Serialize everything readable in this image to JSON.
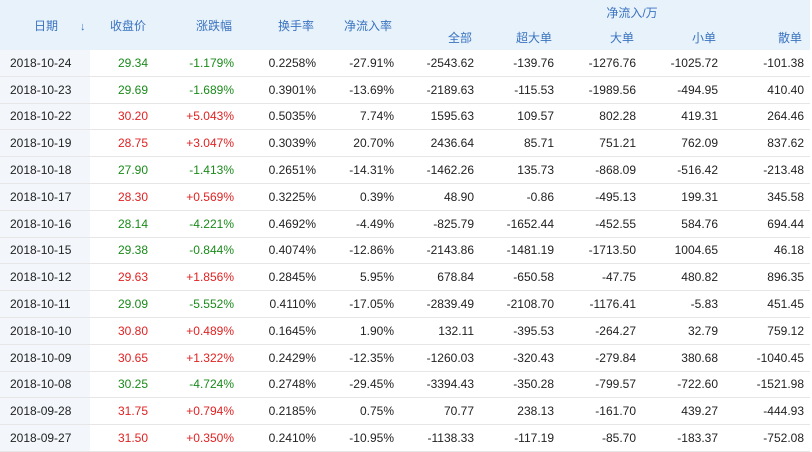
{
  "header": {
    "date": "日期",
    "close": "收盘价",
    "change": "涨跌幅",
    "turnover": "换手率",
    "net_inflow_rate": "净流入率",
    "net_inflow_group": "净流入/万",
    "all": "全部",
    "super_large": "超大单",
    "large": "大单",
    "small": "小单",
    "retail": "散单",
    "sort_icon": "↓"
  },
  "colors": {
    "up": "#e02222",
    "down": "#1a8a1a",
    "header_text": "#3a73c0",
    "header_bg": "#e8f2fb"
  },
  "rows": [
    {
      "date": "2018-10-24",
      "close": "29.34",
      "change": "-1.179%",
      "turnover": "0.2258%",
      "rate": "-27.91%",
      "all": "-2543.62",
      "super": "-139.76",
      "large": "-1276.76",
      "small": "-1025.72",
      "retail": "-101.38",
      "dir": "down"
    },
    {
      "date": "2018-10-23",
      "close": "29.69",
      "change": "-1.689%",
      "turnover": "0.3901%",
      "rate": "-13.69%",
      "all": "-2189.63",
      "super": "-115.53",
      "large": "-1989.56",
      "small": "-494.95",
      "retail": "410.40",
      "dir": "down"
    },
    {
      "date": "2018-10-22",
      "close": "30.20",
      "change": "+5.043%",
      "turnover": "0.5035%",
      "rate": "7.74%",
      "all": "1595.63",
      "super": "109.57",
      "large": "802.28",
      "small": "419.31",
      "retail": "264.46",
      "dir": "up"
    },
    {
      "date": "2018-10-19",
      "close": "28.75",
      "change": "+3.047%",
      "turnover": "0.3039%",
      "rate": "20.70%",
      "all": "2436.64",
      "super": "85.71",
      "large": "751.21",
      "small": "762.09",
      "retail": "837.62",
      "dir": "up"
    },
    {
      "date": "2018-10-18",
      "close": "27.90",
      "change": "-1.413%",
      "turnover": "0.2651%",
      "rate": "-14.31%",
      "all": "-1462.26",
      "super": "135.73",
      "large": "-868.09",
      "small": "-516.42",
      "retail": "-213.48",
      "dir": "down"
    },
    {
      "date": "2018-10-17",
      "close": "28.30",
      "change": "+0.569%",
      "turnover": "0.3225%",
      "rate": "0.39%",
      "all": "48.90",
      "super": "-0.86",
      "large": "-495.13",
      "small": "199.31",
      "retail": "345.58",
      "dir": "up"
    },
    {
      "date": "2018-10-16",
      "close": "28.14",
      "change": "-4.221%",
      "turnover": "0.4692%",
      "rate": "-4.49%",
      "all": "-825.79",
      "super": "-1652.44",
      "large": "-452.55",
      "small": "584.76",
      "retail": "694.44",
      "dir": "down"
    },
    {
      "date": "2018-10-15",
      "close": "29.38",
      "change": "-0.844%",
      "turnover": "0.4074%",
      "rate": "-12.86%",
      "all": "-2143.86",
      "super": "-1481.19",
      "large": "-1713.50",
      "small": "1004.65",
      "retail": "46.18",
      "dir": "down"
    },
    {
      "date": "2018-10-12",
      "close": "29.63",
      "change": "+1.856%",
      "turnover": "0.2845%",
      "rate": "5.95%",
      "all": "678.84",
      "super": "-650.58",
      "large": "-47.75",
      "small": "480.82",
      "retail": "896.35",
      "dir": "up"
    },
    {
      "date": "2018-10-11",
      "close": "29.09",
      "change": "-5.552%",
      "turnover": "0.4110%",
      "rate": "-17.05%",
      "all": "-2839.49",
      "super": "-2108.70",
      "large": "-1176.41",
      "small": "-5.83",
      "retail": "451.45",
      "dir": "down"
    },
    {
      "date": "2018-10-10",
      "close": "30.80",
      "change": "+0.489%",
      "turnover": "0.1645%",
      "rate": "1.90%",
      "all": "132.11",
      "super": "-395.53",
      "large": "-264.27",
      "small": "32.79",
      "retail": "759.12",
      "dir": "up"
    },
    {
      "date": "2018-10-09",
      "close": "30.65",
      "change": "+1.322%",
      "turnover": "0.2429%",
      "rate": "-12.35%",
      "all": "-1260.03",
      "super": "-320.43",
      "large": "-279.84",
      "small": "380.68",
      "retail": "-1040.45",
      "dir": "up"
    },
    {
      "date": "2018-10-08",
      "close": "30.25",
      "change": "-4.724%",
      "turnover": "0.2748%",
      "rate": "-29.45%",
      "all": "-3394.43",
      "super": "-350.28",
      "large": "-799.57",
      "small": "-722.60",
      "retail": "-1521.98",
      "dir": "down"
    },
    {
      "date": "2018-09-28",
      "close": "31.75",
      "change": "+0.794%",
      "turnover": "0.2185%",
      "rate": "0.75%",
      "all": "70.77",
      "super": "238.13",
      "large": "-161.70",
      "small": "439.27",
      "retail": "-444.93",
      "dir": "up"
    },
    {
      "date": "2018-09-27",
      "close": "31.50",
      "change": "+0.350%",
      "turnover": "0.2410%",
      "rate": "-10.95%",
      "all": "-1138.33",
      "super": "-117.19",
      "large": "-85.70",
      "small": "-183.37",
      "retail": "-752.08",
      "dir": "up"
    }
  ]
}
